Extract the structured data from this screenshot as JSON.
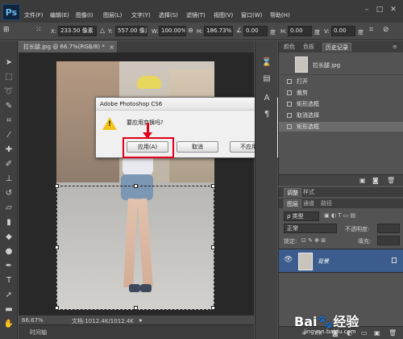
{
  "app": {
    "logo": "Ps"
  },
  "menu": [
    "文件(F)",
    "编辑(E)",
    "图像(I)",
    "图层(L)",
    "文字(Y)",
    "选择(S)",
    "滤镜(T)",
    "视图(V)",
    "窗口(W)",
    "帮助(H)"
  ],
  "window_controls": [
    "–",
    "□",
    "✕"
  ],
  "options": {
    "x_label": "X:",
    "x_value": "233.50 像素",
    "y_label": "Y:",
    "y_value": "557.00 像素",
    "w_label": "W:",
    "w_value": "100.00%",
    "h_label": "H:",
    "h_value": "186.73%",
    "angle_value": "0.00",
    "angle_unit": "度",
    "hskew_label": "H:",
    "hskew_value": "0.00",
    "hskew_unit": "度",
    "vskew_label": "V:",
    "vskew_value": "0.00",
    "vskew_unit": "度"
  },
  "document_tab": {
    "title": "拉长腿.jpg @ 66.7%(RGB/8) *",
    "close": "×"
  },
  "dialog": {
    "title": "Adobe Photoshop CS6",
    "message": "要应用变换吗?",
    "buttons": {
      "apply": "应用(A)",
      "cancel": "取消",
      "dont_apply": "不应用(D)"
    }
  },
  "status": {
    "zoom": "66.67%",
    "doc_size": "文档:1012.4K/1012.4K",
    "timeline": "时间轴"
  },
  "history": {
    "tabs": [
      "颜色",
      "色板",
      "历史记录"
    ],
    "active_tab": "历史记录",
    "snapshot": "拉长腿.jpg",
    "steps": [
      "打开",
      "裁剪",
      "矩形选框",
      "取消选择",
      "矩形选框"
    ],
    "selected_index": 4
  },
  "adjustments_tabs": [
    "调整",
    "样式"
  ],
  "layers": {
    "tabs": [
      "图层",
      "通道",
      "路径"
    ],
    "kind_filter": "ρ 类型",
    "blend_mode": "正常",
    "opacity_label": "不透明度:",
    "lock_label": "锁定:",
    "fill_label": "填充:",
    "layer_name": "背景"
  },
  "watermark": {
    "main": "Bai🐾经验",
    "sub": "jingyan.baidu.com"
  },
  "colors": {
    "accent_red": "#e2001a",
    "selected_row": "#3c5c8e"
  }
}
